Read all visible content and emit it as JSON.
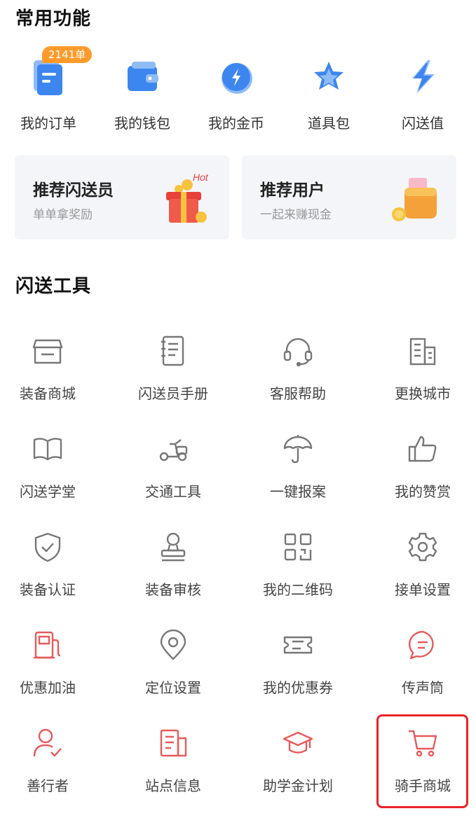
{
  "common": {
    "title": "常用功能",
    "items": [
      {
        "label": "我的订单",
        "badge": "2141单",
        "icon": "order-icon"
      },
      {
        "label": "我的钱包",
        "icon": "wallet-icon"
      },
      {
        "label": "我的金币",
        "icon": "coin-icon"
      },
      {
        "label": "道具包",
        "icon": "props-icon"
      },
      {
        "label": "闪送值",
        "icon": "flash-value-icon"
      }
    ]
  },
  "promos": [
    {
      "title": "推荐闪送员",
      "subtitle": "单单拿奖励",
      "hot": "Hot",
      "icon": "gift-box-icon"
    },
    {
      "title": "推荐用户",
      "subtitle": "一起来赚现金",
      "icon": "money-wallet-icon"
    }
  ],
  "tools": {
    "title": "闪送工具",
    "items": [
      {
        "label": "装备商城",
        "icon": "store-icon"
      },
      {
        "label": "闪送员手册",
        "icon": "manual-icon"
      },
      {
        "label": "客服帮助",
        "icon": "headset-icon"
      },
      {
        "label": "更换城市",
        "icon": "building-icon"
      },
      {
        "label": "闪送学堂",
        "icon": "book-icon"
      },
      {
        "label": "交通工具",
        "icon": "scooter-icon"
      },
      {
        "label": "一键报案",
        "icon": "umbrella-icon"
      },
      {
        "label": "我的赞赏",
        "icon": "thumbs-up-icon"
      },
      {
        "label": "装备认证",
        "icon": "shield-check-icon"
      },
      {
        "label": "装备审核",
        "icon": "stamp-icon"
      },
      {
        "label": "我的二维码",
        "icon": "qr-code-icon"
      },
      {
        "label": "接单设置",
        "icon": "gear-icon"
      },
      {
        "label": "优惠加油",
        "icon": "fuel-icon"
      },
      {
        "label": "定位设置",
        "icon": "location-pin-icon"
      },
      {
        "label": "我的优惠券",
        "icon": "coupon-icon"
      },
      {
        "label": "传声筒",
        "icon": "chat-bubble-icon"
      },
      {
        "label": "善行者",
        "icon": "user-check-icon"
      },
      {
        "label": "站点信息",
        "icon": "station-icon"
      },
      {
        "label": "助学金计划",
        "icon": "graduation-cap-icon"
      },
      {
        "label": "骑手商城",
        "icon": "cart-icon"
      }
    ]
  },
  "colors": {
    "blue": "#3d86f0",
    "gray_icon": "#777777",
    "red_icon": "#e85a5a",
    "highlight": "#e8242a",
    "badge": "#ff9a2b"
  }
}
